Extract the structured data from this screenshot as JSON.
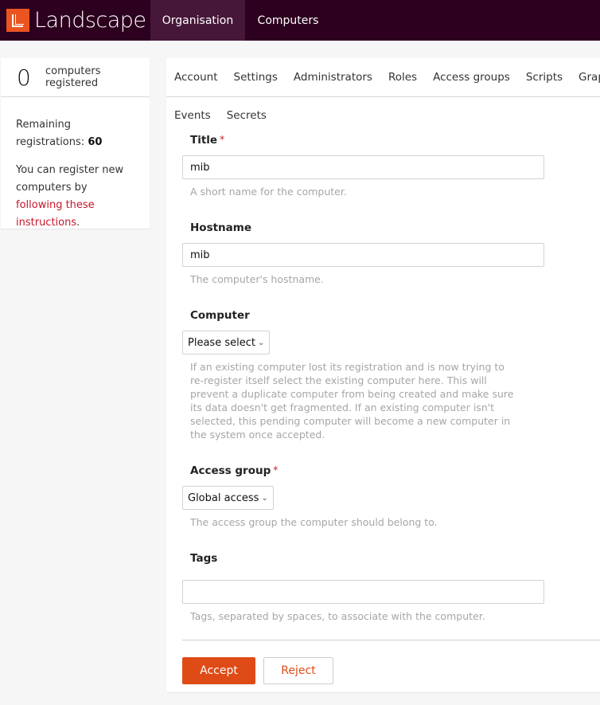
{
  "header": {
    "brand": "Landscape",
    "nav": [
      {
        "label": "Organisation",
        "active": true
      },
      {
        "label": "Computers",
        "active": false
      }
    ]
  },
  "sidebar": {
    "count": "0",
    "count_label_1": "computers",
    "count_label_2": "registered",
    "remaining_label": "Remaining registrations:",
    "remaining_value": "60",
    "register_text": "You can register new computers by",
    "register_link": "following these instructions",
    "register_suffix": "."
  },
  "tabs": {
    "row1": [
      "Account",
      "Settings",
      "Administrators",
      "Roles",
      "Access groups",
      "Scripts",
      "Graphs"
    ],
    "row2": [
      "Events",
      "Secrets"
    ]
  },
  "form": {
    "title": {
      "label": "Title",
      "required": "*",
      "value": "mib",
      "help": "A short name for the computer."
    },
    "hostname": {
      "label": "Hostname",
      "value": "mib",
      "help": "The computer's hostname."
    },
    "computer": {
      "label": "Computer",
      "selected": "Please select",
      "help": "If an existing computer lost its registration and is now trying to re-register itself select the existing computer here. This will prevent a duplicate computer from being created and make sure its data doesn't get fragmented. If an existing computer isn't selected, this pending computer will become a new computer in the system once accepted."
    },
    "access_group": {
      "label": "Access group",
      "required": "*",
      "selected": "Global access",
      "help": "The access group the computer should belong to."
    },
    "tags": {
      "label": "Tags",
      "value": "",
      "help": "Tags, separated by spaces, to associate with the computer."
    },
    "chevron": "⌄"
  },
  "actions": {
    "accept": "Accept",
    "reject": "Reject"
  },
  "colors": {
    "header_bg": "#2c001e",
    "nav_active_bg": "#461739",
    "accent": "#e95420",
    "link": "#c7162b"
  }
}
